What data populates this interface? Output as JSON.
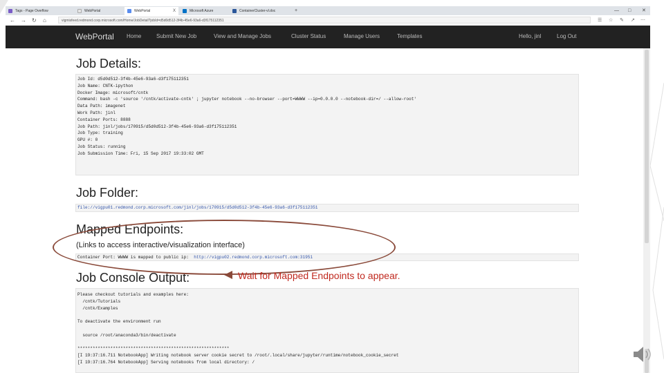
{
  "browser": {
    "tabs": [
      {
        "label": "Tags - Page Overflow",
        "color": "#7a5cc7"
      },
      {
        "label": "WebPortal",
        "color": "#f2f2f2"
      },
      {
        "label": "WebPortal",
        "color": "#5a8dee"
      },
      {
        "label": "Microsoft Azure",
        "color": "#0072c6"
      },
      {
        "label": "ContainerCluster-vl.doc",
        "color": "#2b579a"
      }
    ],
    "url": "vigmisfeed.redmond.corp.microsoft.com/Home/JobDetail?jobId=d5d0d512-3f4b-45e6-93a6-d3f175112351",
    "tab_close": "X"
  },
  "navbar": {
    "brand": "WebPortal",
    "links": [
      "Home",
      "Submit New Job",
      "View and Manage Jobs",
      "Cluster Status",
      "Manage Users",
      "Templates"
    ],
    "greeting": "Hello, jinl",
    "logout": "Log Out"
  },
  "job_details": {
    "heading": "Job Details:",
    "lines": [
      "Job Id: d5d0d512-3f4b-45e6-93a6-d3f175112351",
      "Job Name: CNTK-ipython",
      "Docker Image: microsoft/cntk",
      "Command: bash -c 'source '/cntk/activate-cntk' ; jupyter notebook --no-browser --port=WWWW --ip=0.0.0.0 --notebook-dir=/ --allow-root'",
      "Data Path: imagenet",
      "Work Path: jinl",
      "Container Ports: 8888",
      "Job Path: jinl/jobs/170915/d5d0d512-3f4b-45e6-93a6-d3f175112351",
      "Job Type: training",
      "GPU #: 0",
      "Job Status: running",
      "Job Submission Time: Fri, 15 Sep 2017 19:33:02 GMT"
    ]
  },
  "job_folder": {
    "heading": "Job Folder:",
    "path": "file://vigpu01.redmond.corp.microsoft.com/jinl/jobs/170915/d5d0d512-3f4b-45e6-93a6-d3f175112351"
  },
  "mapped_endpoints": {
    "heading": "Mapped Endpoints:",
    "subtitle": "(Links to access interactive/visualization interface)",
    "line_prefix": "Container Port: WWWW is mapped to public ip:  ",
    "line_link": "http://vigpu02.redmond.corp.microsoft.com:31951"
  },
  "console": {
    "heading": "Job Console Output:",
    "lines": [
      "Please checkout tutorials and examples here:",
      "  /cntk/Tutorials",
      "  /cntk/Examples",
      "",
      "To deactivate the environment run",
      "",
      "  source /root/anaconda3/bin/deactivate",
      "",
      "************************************************************",
      "[I 19:37:16.711 NotebookApp] Writing notebook server cookie secret to /root/.local/share/jupyter/runtime/notebook_cookie_secret",
      "[I 19:37:16.764 NotebookApp] Serving notebooks from local directory: /"
    ]
  },
  "annotation": {
    "text": "Wait for Mapped Endpoints to appear."
  }
}
